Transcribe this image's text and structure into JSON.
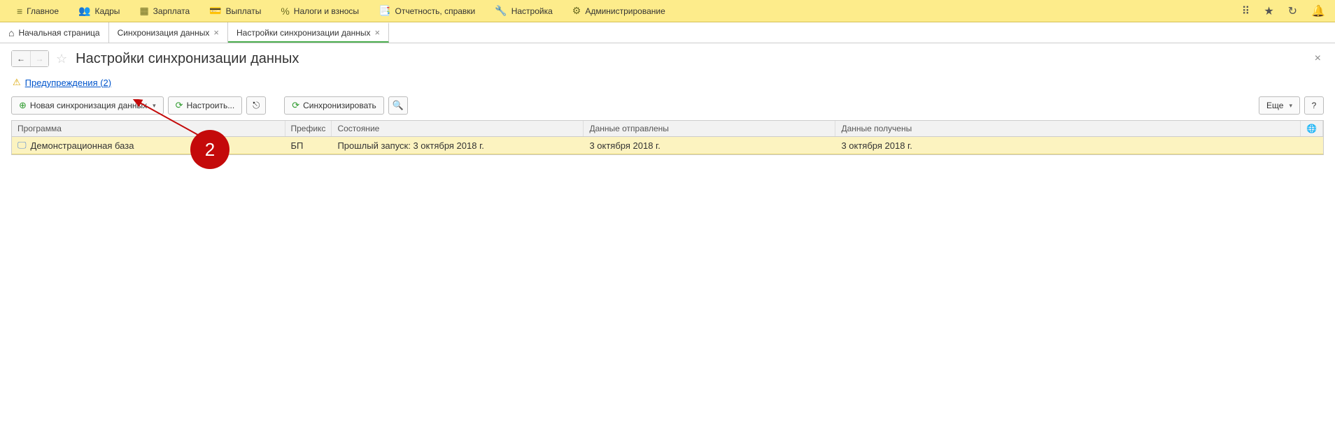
{
  "topmenu": {
    "items": [
      {
        "icon": "≡",
        "label": "Главное"
      },
      {
        "icon": "👥",
        "label": "Кадры"
      },
      {
        "icon": "▦",
        "label": "Зарплата"
      },
      {
        "icon": "💳",
        "label": "Выплаты"
      },
      {
        "icon": "%",
        "label": "Налоги и взносы"
      },
      {
        "icon": "📑",
        "label": "Отчетность, справки"
      },
      {
        "icon": "🔧",
        "label": "Настройка"
      },
      {
        "icon": "⚙",
        "label": "Администрирование"
      }
    ]
  },
  "tabs": {
    "home": "Начальная страница",
    "t1": "Синхронизация данных",
    "t2": "Настройки синхронизации данных"
  },
  "page": {
    "title": "Настройки синхронизации данных"
  },
  "warnings": {
    "text": "Предупреждения (2)"
  },
  "toolbar": {
    "new_sync": "Новая синхронизация данных",
    "configure": "Настроить...",
    "sync": "Синхронизировать",
    "more": "Еще",
    "help": "?"
  },
  "table": {
    "headers": {
      "program": "Программа",
      "prefix": "Префикс",
      "status": "Состояние",
      "sent": "Данные отправлены",
      "received": "Данные получены"
    },
    "row": {
      "program": "Демонстрационная база",
      "prefix": "БП",
      "status": "Прошлый запуск: 3 октября 2018 г.",
      "sent": "3 октября 2018 г.",
      "received": "3 октября 2018 г."
    }
  },
  "annotation": {
    "number": "2"
  }
}
